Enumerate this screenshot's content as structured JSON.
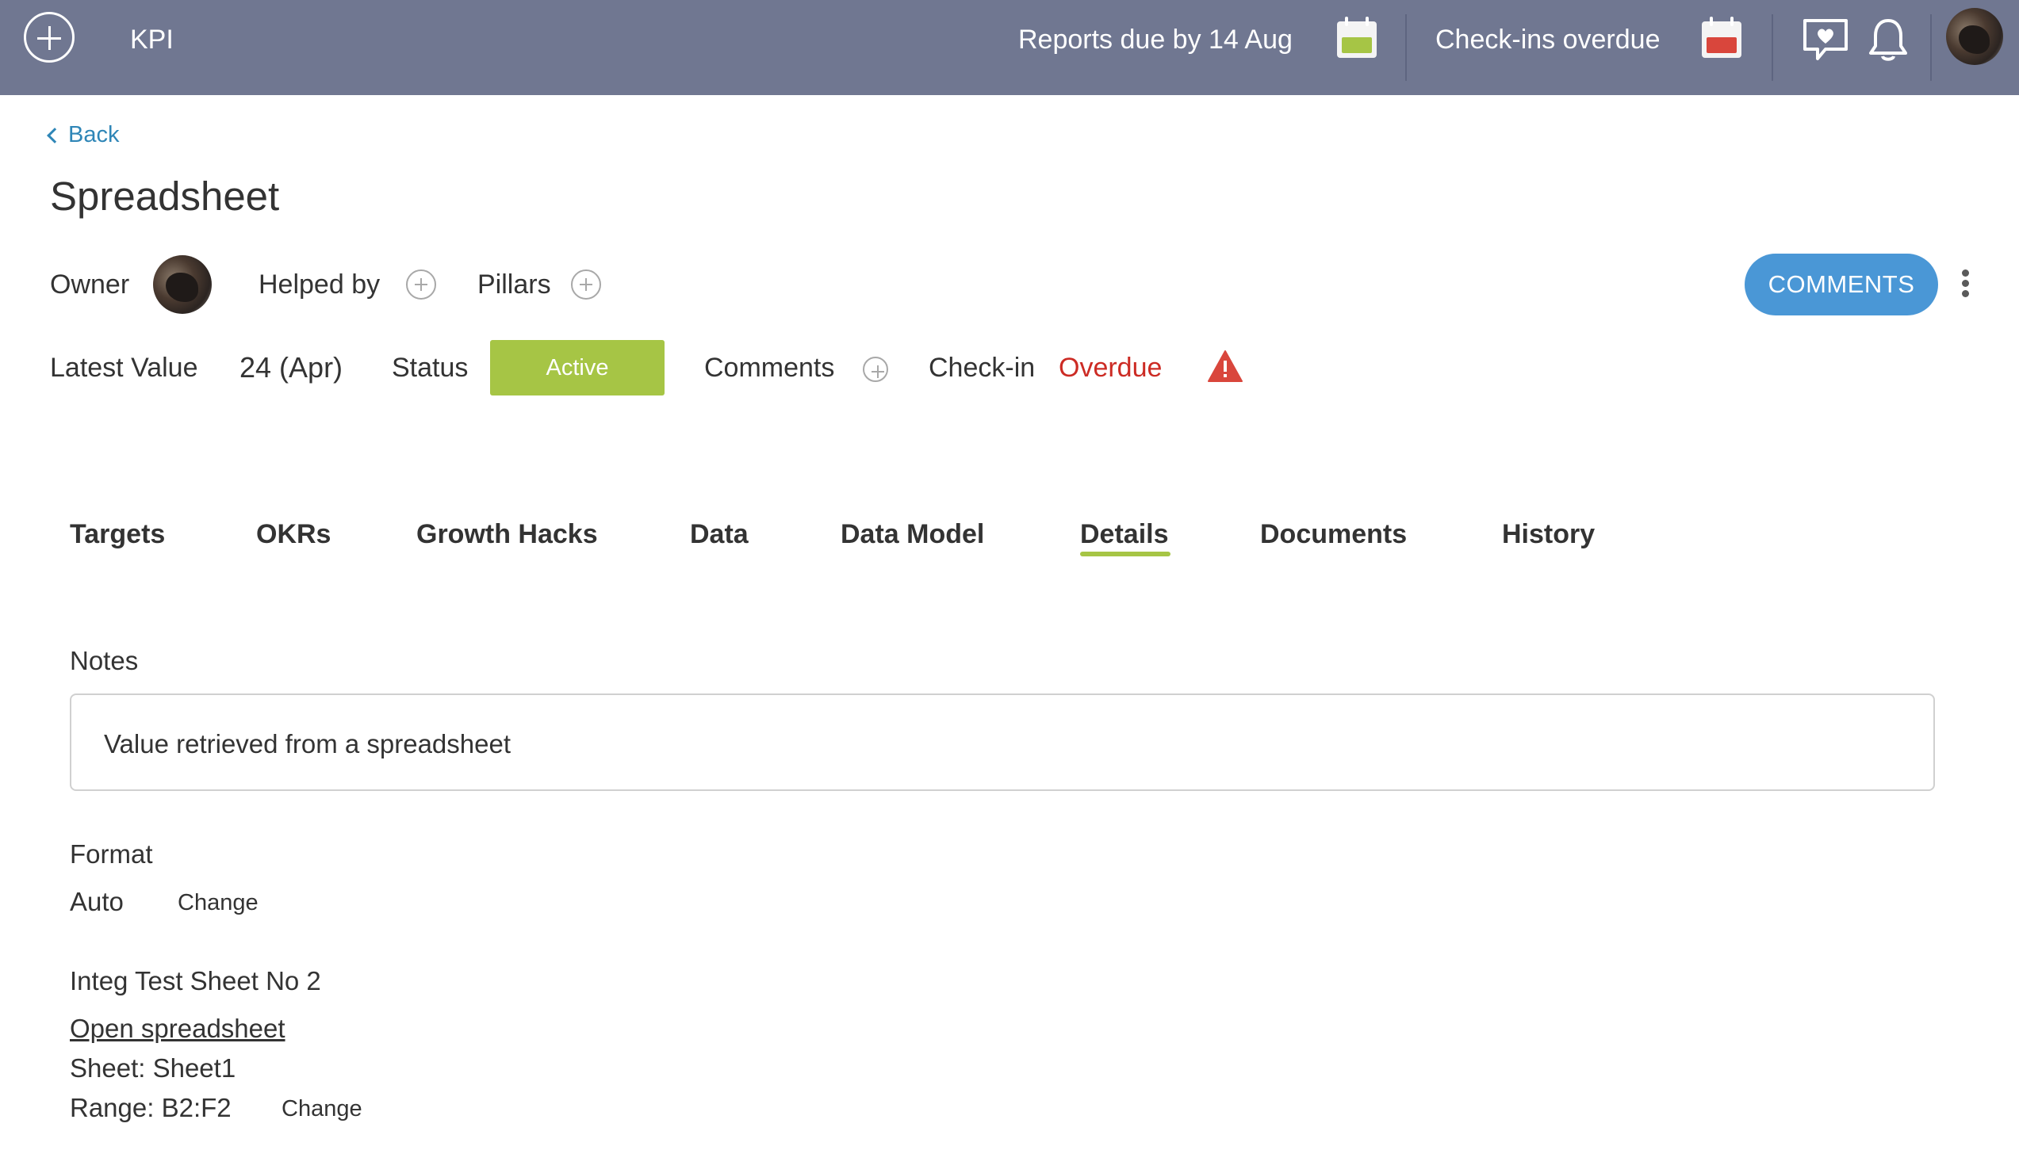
{
  "topbar": {
    "add_icon": "plus-circle-icon",
    "section": "KPI",
    "reports_due": "Reports due by 14 Aug",
    "reports_calendar_color": "#a6c545",
    "checkins_overdue": "Check-ins overdue",
    "checkins_calendar_color": "#d9463c",
    "feedback_icon": "chat-heart-icon",
    "notifications_icon": "bell-icon"
  },
  "page": {
    "back_label": "Back",
    "title": "Spreadsheet",
    "owner_label": "Owner",
    "helped_by_label": "Helped by",
    "pillars_label": "Pillars",
    "comments_button": "COMMENTS",
    "latest_value_label": "Latest Value",
    "latest_value": "24 (Apr)",
    "status_label": "Status",
    "status_value": "Active",
    "comments_label": "Comments",
    "checkin_label": "Check-in",
    "checkin_value": "Overdue"
  },
  "tabs": [
    {
      "label": "Targets",
      "active": false
    },
    {
      "label": "OKRs",
      "active": false
    },
    {
      "label": "Growth Hacks",
      "active": false
    },
    {
      "label": "Data",
      "active": false
    },
    {
      "label": "Data Model",
      "active": false
    },
    {
      "label": "Details",
      "active": true
    },
    {
      "label": "Documents",
      "active": false
    },
    {
      "label": "History",
      "active": false
    }
  ],
  "details": {
    "notes_label": "Notes",
    "notes_value": "Value retrieved from a spreadsheet",
    "format_label": "Format",
    "format_value": "Auto",
    "format_change": "Change",
    "sheet_name": "Integ Test Sheet No 2",
    "open_link": "Open spreadsheet",
    "sheet_line": "Sheet: Sheet1",
    "range_line": "Range: B2:F2",
    "range_change": "Change"
  },
  "colors": {
    "topbar": "#707791",
    "accent_blue": "#4a97d6",
    "status_green": "#a6c545",
    "overdue_red": "#cc2b24",
    "link_blue": "#2f86b7"
  }
}
